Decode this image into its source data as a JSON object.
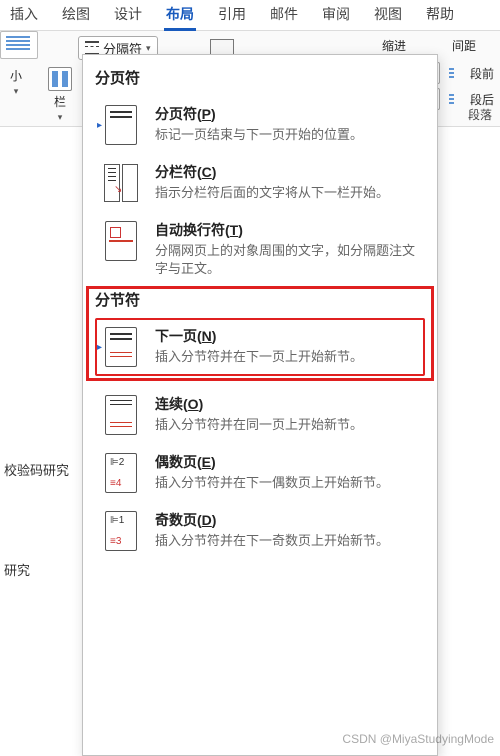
{
  "tabs": {
    "insert": "插入",
    "draw": "绘图",
    "design": "设计",
    "layout": "布局",
    "refs": "引用",
    "mail": "邮件",
    "review": "审阅",
    "view": "视图",
    "help": "帮助"
  },
  "ribbon": {
    "size": "小",
    "columns": "栏",
    "breaks": "分隔符",
    "indent_group": "缩进",
    "spacing_group": "间距",
    "space_before": "段前",
    "space_after": "段后",
    "paragraph": "段落"
  },
  "dropdown": {
    "group_page": "分页符",
    "group_section": "分节符",
    "items": {
      "page": {
        "title": "分页符(",
        "accel": "P",
        "title2": ")",
        "desc": "标记一页结束与下一页开始的位置。"
      },
      "column": {
        "title": "分栏符(",
        "accel": "C",
        "title2": ")",
        "desc": "指示分栏符后面的文字将从下一栏开始。"
      },
      "wrap": {
        "title": "自动换行符(",
        "accel": "T",
        "title2": ")",
        "desc": "分隔网页上的对象周围的文字，如分隔题注文字与正文。"
      },
      "next": {
        "title": "下一页(",
        "accel": "N",
        "title2": ")",
        "desc": "插入分节符并在下一页上开始新节。"
      },
      "cont": {
        "title": "连续(",
        "accel": "O",
        "title2": ")",
        "desc": "插入分节符并在同一页上开始新节。"
      },
      "even": {
        "title": "偶数页(",
        "accel": "E",
        "title2": ")",
        "desc": "插入分节符并在下一偶数页上开始新节。"
      },
      "odd": {
        "title": "奇数页(",
        "accel": "D",
        "title2": ")",
        "desc": "插入分节符并在下一奇数页上开始新节。"
      }
    }
  },
  "bg": {
    "a": "校验码研究",
    "b": "研究"
  },
  "watermark": "CSDN @MiyaStudyingMode"
}
